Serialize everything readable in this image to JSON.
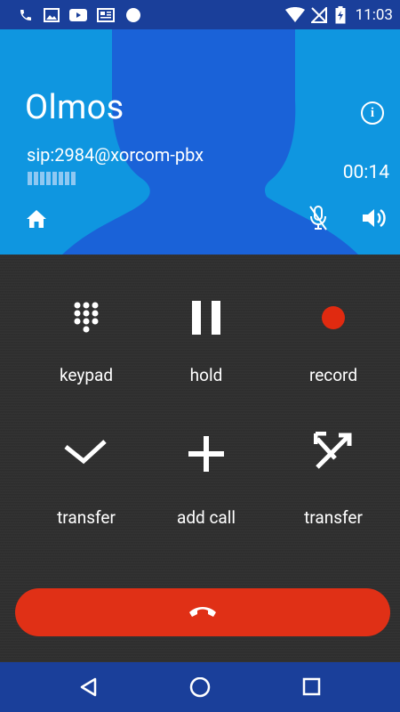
{
  "status_bar": {
    "time": "11:03",
    "left_icons": [
      "phone-icon",
      "image-icon",
      "youtube-icon",
      "news-icon",
      "circle-icon"
    ],
    "right_icons": [
      "wifi-icon",
      "no-signal-icon",
      "battery-charging-icon"
    ]
  },
  "call": {
    "name": "Olmos",
    "sip_address": "sip:2984@xorcom-pbx",
    "duration": "00:14",
    "signal_level_bars": 8,
    "info_glyph": "i"
  },
  "controls": [
    {
      "id": "keypad",
      "label": "keypad"
    },
    {
      "id": "hold",
      "label": "hold"
    },
    {
      "id": "record",
      "label": "record"
    },
    {
      "id": "transfer-attended",
      "label": "transfer"
    },
    {
      "id": "add-call",
      "label": "add call"
    },
    {
      "id": "transfer-blind",
      "label": "transfer"
    }
  ],
  "colors": {
    "header_blue": "#0f96e0",
    "silhouette_blue": "#1a62d8",
    "status_bar": "#1a3f9a",
    "hangup_red": "#e03016",
    "record_red": "#e02a10",
    "panel_bg": "#2e2e2e"
  },
  "nav": [
    "back-icon",
    "home-icon",
    "recents-icon"
  ]
}
